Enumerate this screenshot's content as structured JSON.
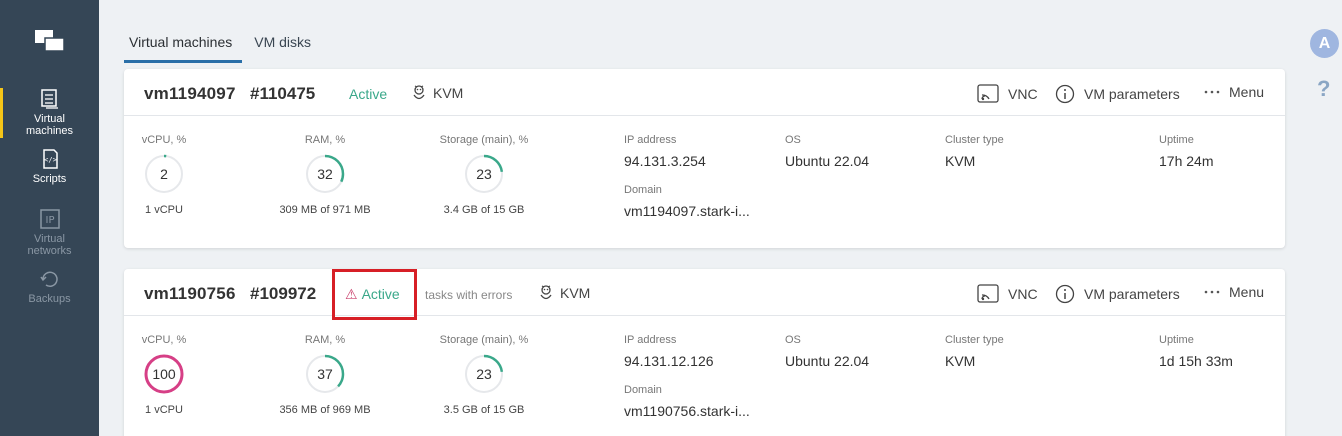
{
  "sidebar": {
    "items": [
      {
        "label_line1": "Virtual",
        "label_line2": "machines",
        "icon": "virtual-machines-icon"
      },
      {
        "label_line1": "Scripts",
        "label_line2": "",
        "icon": "scripts-icon"
      },
      {
        "label_line1": "Virtual",
        "label_line2": "networks",
        "icon": "ip-icon"
      },
      {
        "label_line1": "Backups",
        "label_line2": "",
        "icon": "backups-icon"
      }
    ]
  },
  "tabs": [
    {
      "label": "Virtual machines"
    },
    {
      "label": "VM disks"
    }
  ],
  "user": {
    "avatar_letter": "A",
    "help": "?"
  },
  "actions": {
    "vnc": "VNC",
    "vm_parameters": "VM parameters",
    "menu": "Menu"
  },
  "labels": {
    "vcpu": "vCPU, %",
    "ram": "RAM, %",
    "storage": "Storage (main), %",
    "ip": "IP address",
    "domain": "Domain",
    "os": "OS",
    "cluster": "Cluster type",
    "uptime": "Uptime"
  },
  "vms": [
    {
      "name": "vm1194097",
      "id": "#110475",
      "status": "Active",
      "tasks_note": "",
      "virtualization": "KVM",
      "vcpu_value": "2",
      "vcpu_fraction": 0.02,
      "vcpu_sub": "1 vCPU",
      "ram_value": "32",
      "ram_fraction": 0.32,
      "ram_sub": "309 MB of 971 MB",
      "storage_value": "23",
      "storage_fraction": 0.23,
      "storage_sub": "3.4 GB of 15 GB",
      "ip": "94.131.3.254",
      "domain": "vm1194097.stark-i...",
      "os": "Ubuntu 22.04",
      "cluster": "KVM",
      "uptime": "17h 24m"
    },
    {
      "name": "vm1190756",
      "id": "#109972",
      "status": "Active",
      "tasks_note": "tasks with errors",
      "virtualization": "KVM",
      "vcpu_value": "100",
      "vcpu_fraction": 1.0,
      "vcpu_sub": "1 vCPU",
      "ram_value": "37",
      "ram_fraction": 0.37,
      "ram_sub": "356 MB of 969 MB",
      "storage_value": "23",
      "storage_fraction": 0.23,
      "storage_sub": "3.5 GB of 15 GB",
      "ip": "94.131.12.126",
      "domain": "vm1190756.stark-i...",
      "os": "Ubuntu 22.04",
      "cluster": "KVM",
      "uptime": "1d 15h 33m"
    }
  ],
  "colors": {
    "ok": "#3aa88a",
    "critical": "#d63f86",
    "warning": "#c9426d",
    "highlight": "#d71f26"
  }
}
